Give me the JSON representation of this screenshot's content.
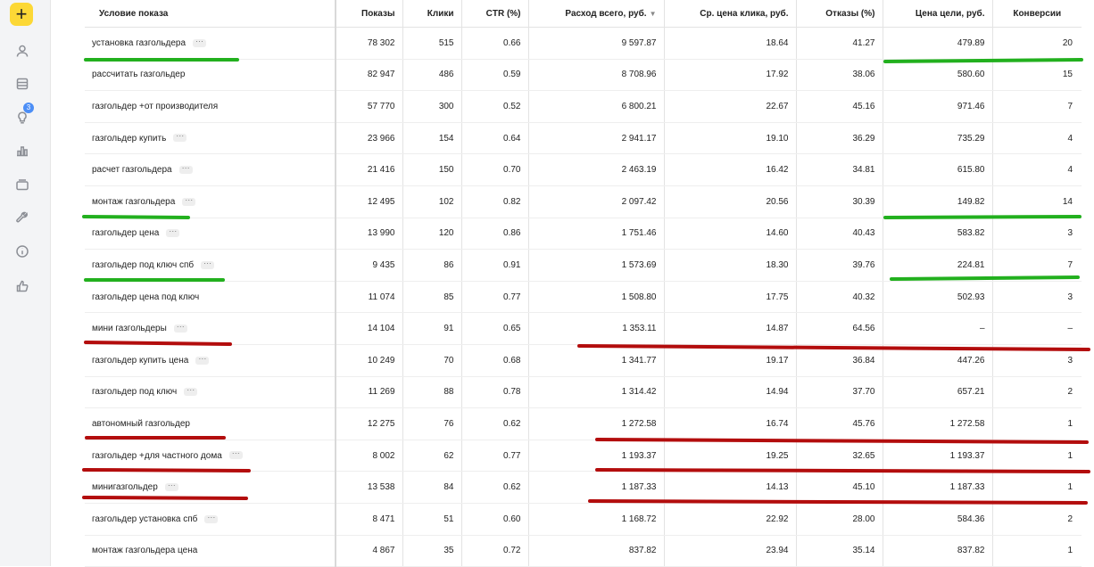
{
  "sidebar": {
    "add_label": "+",
    "icons": [
      "user-icon",
      "list-icon",
      "lightbulb-icon",
      "bar-chart-icon",
      "briefcase-icon",
      "wrench-icon",
      "info-icon",
      "thumbs-up-icon"
    ],
    "badge_count": "3"
  },
  "table": {
    "columns": [
      "Условие показа",
      "Показы",
      "Клики",
      "CTR (%)",
      "Расход всего, руб.",
      "Ср. цена клика, руб.",
      "Отказы (%)",
      "Цена цели, руб.",
      "Конверсии"
    ],
    "sort_indicator": "▼",
    "more_label": "···",
    "rows": [
      {
        "cond": "установка газгольдера",
        "more": true,
        "shows": "78 302",
        "clicks": "515",
        "ctr": "0.66",
        "spend": "9 597.87",
        "cpc": "18.64",
        "bounce": "41.27",
        "goal_price": "479.89",
        "conv": "20"
      },
      {
        "cond": "рассчитать газгольдер",
        "more": false,
        "shows": "82 947",
        "clicks": "486",
        "ctr": "0.59",
        "spend": "8 708.96",
        "cpc": "17.92",
        "bounce": "38.06",
        "goal_price": "580.60",
        "conv": "15"
      },
      {
        "cond": "газгольдер +от производителя",
        "more": false,
        "shows": "57 770",
        "clicks": "300",
        "ctr": "0.52",
        "spend": "6 800.21",
        "cpc": "22.67",
        "bounce": "45.16",
        "goal_price": "971.46",
        "conv": "7"
      },
      {
        "cond": "газгольдер купить",
        "more": true,
        "shows": "23 966",
        "clicks": "154",
        "ctr": "0.64",
        "spend": "2 941.17",
        "cpc": "19.10",
        "bounce": "36.29",
        "goal_price": "735.29",
        "conv": "4"
      },
      {
        "cond": "расчет газгольдера",
        "more": true,
        "shows": "21 416",
        "clicks": "150",
        "ctr": "0.70",
        "spend": "2 463.19",
        "cpc": "16.42",
        "bounce": "34.81",
        "goal_price": "615.80",
        "conv": "4"
      },
      {
        "cond": "монтаж газгольдера",
        "more": true,
        "shows": "12 495",
        "clicks": "102",
        "ctr": "0.82",
        "spend": "2 097.42",
        "cpc": "20.56",
        "bounce": "30.39",
        "goal_price": "149.82",
        "conv": "14"
      },
      {
        "cond": "газгольдер цена",
        "more": true,
        "shows": "13 990",
        "clicks": "120",
        "ctr": "0.86",
        "spend": "1 751.46",
        "cpc": "14.60",
        "bounce": "40.43",
        "goal_price": "583.82",
        "conv": "3"
      },
      {
        "cond": "газгольдер под ключ спб",
        "more": true,
        "shows": "9 435",
        "clicks": "86",
        "ctr": "0.91",
        "spend": "1 573.69",
        "cpc": "18.30",
        "bounce": "39.76",
        "goal_price": "224.81",
        "conv": "7"
      },
      {
        "cond": "газгольдер цена под ключ",
        "more": false,
        "shows": "11 074",
        "clicks": "85",
        "ctr": "0.77",
        "spend": "1 508.80",
        "cpc": "17.75",
        "bounce": "40.32",
        "goal_price": "502.93",
        "conv": "3"
      },
      {
        "cond": "мини газгольдеры",
        "more": true,
        "shows": "14 104",
        "clicks": "91",
        "ctr": "0.65",
        "spend": "1 353.11",
        "cpc": "14.87",
        "bounce": "64.56",
        "goal_price": "–",
        "conv": "–"
      },
      {
        "cond": "газгольдер купить цена",
        "more": true,
        "shows": "10 249",
        "clicks": "70",
        "ctr": "0.68",
        "spend": "1 341.77",
        "cpc": "19.17",
        "bounce": "36.84",
        "goal_price": "447.26",
        "conv": "3"
      },
      {
        "cond": "газгольдер под ключ",
        "more": true,
        "shows": "11 269",
        "clicks": "88",
        "ctr": "0.78",
        "spend": "1 314.42",
        "cpc": "14.94",
        "bounce": "37.70",
        "goal_price": "657.21",
        "conv": "2"
      },
      {
        "cond": "автономный газгольдер",
        "more": false,
        "shows": "12 275",
        "clicks": "76",
        "ctr": "0.62",
        "spend": "1 272.58",
        "cpc": "16.74",
        "bounce": "45.76",
        "goal_price": "1 272.58",
        "conv": "1"
      },
      {
        "cond": "газгольдер +для частного дома",
        "more": true,
        "shows": "8 002",
        "clicks": "62",
        "ctr": "0.77",
        "spend": "1 193.37",
        "cpc": "19.25",
        "bounce": "32.65",
        "goal_price": "1 193.37",
        "conv": "1"
      },
      {
        "cond": "минигазгольдер",
        "more": true,
        "shows": "13 538",
        "clicks": "84",
        "ctr": "0.62",
        "spend": "1 187.33",
        "cpc": "14.13",
        "bounce": "45.10",
        "goal_price": "1 187.33",
        "conv": "1"
      },
      {
        "cond": "газгольдер установка спб",
        "more": true,
        "shows": "8 471",
        "clicks": "51",
        "ctr": "0.60",
        "spend": "1 168.72",
        "cpc": "22.92",
        "bounce": "28.00",
        "goal_price": "584.36",
        "conv": "2"
      },
      {
        "cond": "монтаж газгольдера цена",
        "more": false,
        "shows": "4 867",
        "clicks": "35",
        "ctr": "0.72",
        "spend": "837.82",
        "cpc": "23.94",
        "bounce": "35.14",
        "goal_price": "837.82",
        "conv": "1"
      }
    ]
  },
  "annotations": {
    "green": "#22b01e",
    "red": "#b30d0d"
  }
}
